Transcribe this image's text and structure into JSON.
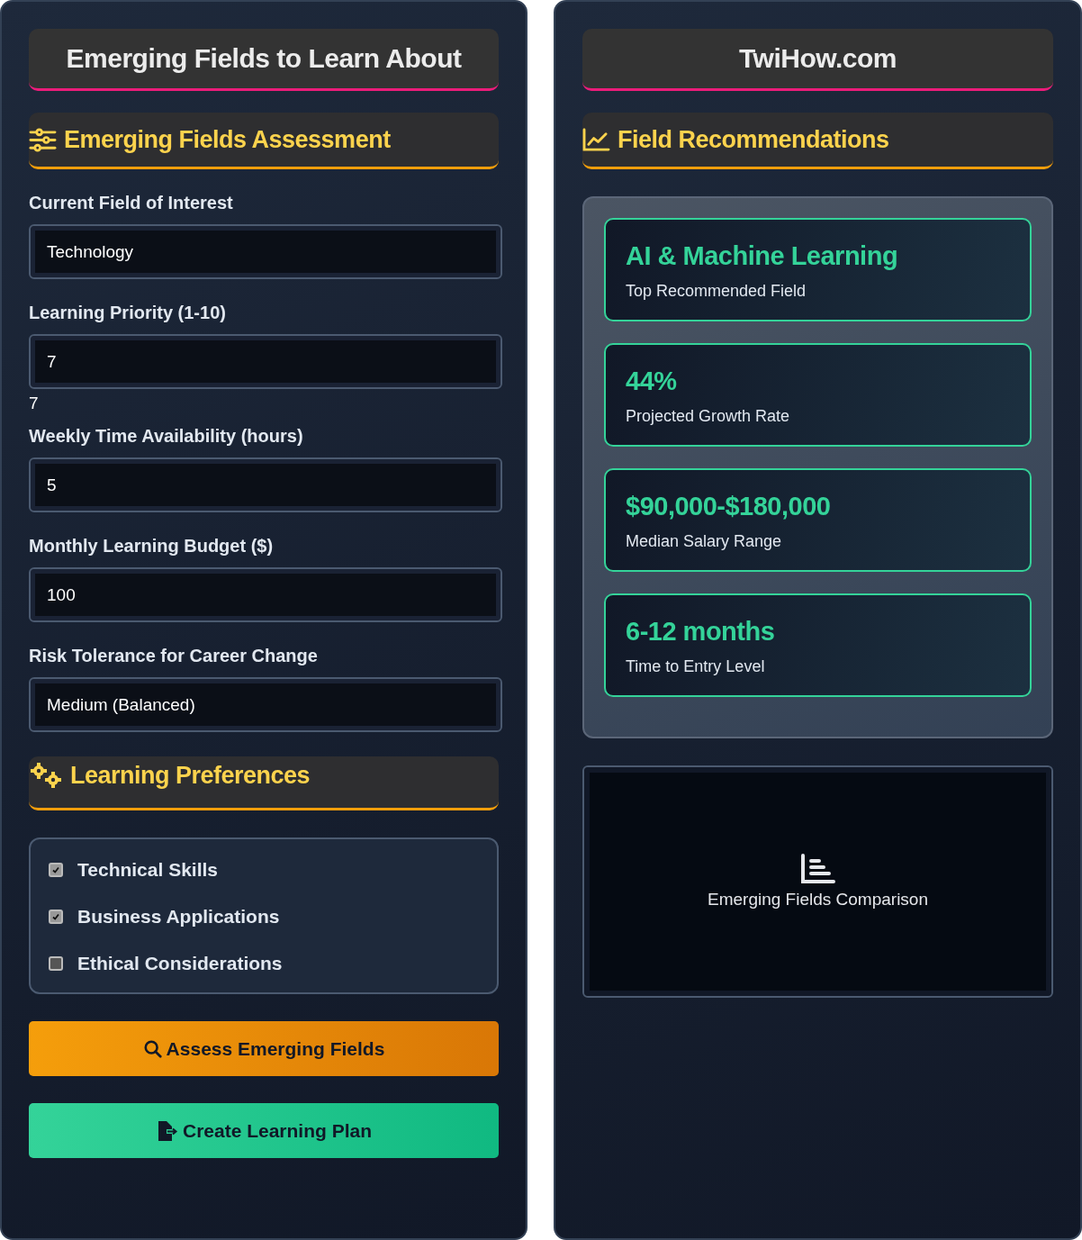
{
  "left_panel": {
    "title": "Emerging Fields to Learn About",
    "assessment": {
      "heading": "Emerging Fields Assessment",
      "fields": [
        {
          "label": "Current Field of Interest",
          "value": "Technology"
        },
        {
          "label": "Learning Priority (1-10)",
          "value": "7",
          "reading": "7"
        },
        {
          "label": "Weekly Time Availability (hours)",
          "value": "5"
        },
        {
          "label": "Monthly Learning Budget ($)",
          "value": "100"
        },
        {
          "label": "Risk Tolerance for Career Change",
          "value": "Medium (Balanced)"
        }
      ]
    },
    "preferences": {
      "heading": "Learning Preferences",
      "options": [
        {
          "label": "Technical Skills",
          "checked": true
        },
        {
          "label": "Business Applications",
          "checked": true
        },
        {
          "label": "Ethical Considerations",
          "checked": false
        }
      ]
    },
    "buttons": [
      {
        "label": "Assess Emerging Fields",
        "kind": "search"
      },
      {
        "label": "Create Learning Plan",
        "kind": "export"
      }
    ]
  },
  "right_panel": {
    "title": "TwiHow.com",
    "recommendations": {
      "heading": "Field Recommendations",
      "cards": [
        {
          "value": "AI & Machine Learning",
          "caption": "Top Recommended Field"
        },
        {
          "value": "44%",
          "caption": "Projected Growth Rate"
        },
        {
          "value": "$90,000-$180,000",
          "caption": "Median Salary Range"
        },
        {
          "value": "6-12 months",
          "caption": "Time to Entry Level"
        }
      ]
    },
    "chart_placeholder": {
      "label": "Emerging Fields Comparison"
    }
  }
}
